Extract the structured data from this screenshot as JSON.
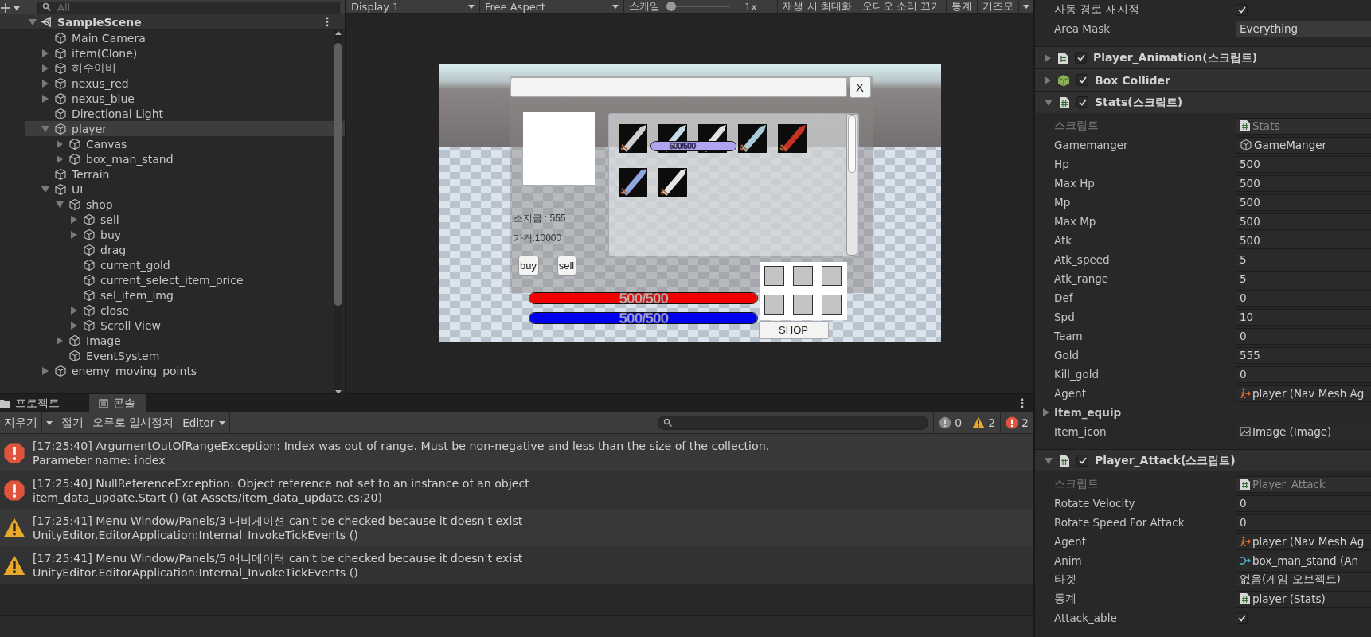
{
  "hierarchy": {
    "search": {
      "placeholder": "All"
    },
    "scene": {
      "name": "SampleScene",
      "expanded": true
    },
    "items": [
      {
        "kind": "leaf",
        "label": "Main Camera",
        "selected": false
      },
      {
        "kind": "parent",
        "label": "item(Clone)",
        "expanded": false,
        "selected": false
      },
      {
        "kind": "parent",
        "label": "허수아비",
        "expanded": false,
        "selected": false
      },
      {
        "kind": "parent",
        "label": "nexus_red",
        "expanded": false,
        "selected": false
      },
      {
        "kind": "parent",
        "label": "nexus_blue",
        "expanded": false,
        "selected": false
      },
      {
        "kind": "leaf",
        "label": "Directional Light",
        "selected": false
      },
      {
        "kind": "parent",
        "label": "player",
        "expanded": true,
        "selected": true,
        "children": [
          {
            "kind": "parent",
            "label": "Canvas",
            "expanded": false,
            "selected": false
          },
          {
            "kind": "parent",
            "label": "box_man_stand",
            "expanded": false,
            "selected": false
          }
        ]
      },
      {
        "kind": "leaf",
        "label": "Terrain",
        "selected": false
      },
      {
        "kind": "parent",
        "label": "UI",
        "expanded": true,
        "selected": false,
        "children": [
          {
            "kind": "parent",
            "label": "shop",
            "expanded": true,
            "selected": false,
            "children": [
              {
                "kind": "parent",
                "label": "sell",
                "expanded": false,
                "selected": false
              },
              {
                "kind": "parent",
                "label": "buy",
                "expanded": false,
                "selected": false
              },
              {
                "kind": "leaf",
                "label": "drag",
                "selected": false
              },
              {
                "kind": "leaf",
                "label": "current_gold",
                "selected": false
              },
              {
                "kind": "leaf",
                "label": "current_select_item_price",
                "selected": false
              },
              {
                "kind": "leaf",
                "label": "sel_item_img",
                "selected": false
              },
              {
                "kind": "parent",
                "label": "close",
                "expanded": false,
                "selected": false
              },
              {
                "kind": "parent",
                "label": "Scroll View",
                "expanded": false,
                "selected": false
              }
            ]
          },
          {
            "kind": "parent",
            "label": "Image",
            "expanded": false,
            "selected": false
          },
          {
            "kind": "leaf",
            "label": "EventSystem",
            "selected": false
          }
        ]
      },
      {
        "kind": "parent",
        "label": "enemy_moving_points",
        "expanded": false,
        "selected": false
      }
    ]
  },
  "game_view": {
    "toolbar": {
      "display": "Display 1",
      "aspect": "Free Aspect",
      "scale_label": "스케일",
      "scale_slider": {
        "level": 0
      },
      "scale_reading": "1x",
      "toggles": [
        {
          "label": "재생 시 최대화",
          "on": false
        },
        {
          "label": "오디오 소리 끄기",
          "on": false
        },
        {
          "label": "통계",
          "on": false
        },
        {
          "label": "기즈모",
          "on": false
        }
      ]
    },
    "shop": {
      "close": "X",
      "item_icons": [
        {
          "color": "#d0d0d0"
        },
        {
          "color": "#c4dce6"
        },
        {
          "color": "#e2e2e2"
        },
        {
          "color": "#a9cbd8"
        },
        {
          "color": "#c83222"
        },
        {
          "color": "#8fa6e0"
        },
        {
          "color": "#e6e6e6"
        }
      ],
      "gold": "소지금 : 555",
      "price": "가격:10000",
      "buttons": [
        {
          "label": "buy"
        },
        {
          "label": "sell"
        }
      ]
    },
    "overhead_hp": {
      "level": 1,
      "reading": "500/500"
    },
    "hp_bar": {
      "level": 1,
      "reading": "500/500"
    },
    "mp_bar": {
      "level": 1,
      "reading": "500/500"
    },
    "shop_button": "SHOP"
  },
  "console": {
    "tabs": [
      {
        "label": "프로젝트",
        "selected": false
      },
      {
        "label": "콘솔",
        "selected": true
      }
    ],
    "toolbar": {
      "clear": "지우기",
      "collapse": "접기",
      "error_pause": "오류로 일시정지",
      "editor": "Editor",
      "counts": [
        {
          "kind": "log",
          "count": "0"
        },
        {
          "kind": "warning",
          "count": "2"
        },
        {
          "kind": "error",
          "count": "2"
        }
      ]
    },
    "messages": [
      {
        "kind": "error",
        "line1": "[17:25:40] ArgumentOutOfRangeException: Index was out of range. Must be non-negative and less than the size of the collection.",
        "line2": "Parameter name: index"
      },
      {
        "kind": "error",
        "line1": "[17:25:40] NullReferenceException: Object reference not set to an instance of an object",
        "line2": "item_data_update.Start () (at Assets/item_data_update.cs:20)"
      },
      {
        "kind": "warning",
        "line1": "[17:25:41] Menu Window/Panels/3 내비게이션  can't be checked because it doesn't exist",
        "line2": "UnityEditor.EditorApplication:Internal_InvokeTickEvents ()"
      },
      {
        "kind": "warning",
        "line1": "[17:25:41] Menu Window/Panels/5 애니메이터  can't be checked because it doesn't exist",
        "line2": "UnityEditor.EditorApplication:Internal_InvokeTickEvents ()"
      }
    ]
  },
  "inspector": {
    "rows": [
      {
        "kind": "checkbox",
        "label": "자동 경로 재지정",
        "checked": true
      },
      {
        "kind": "dropdown",
        "label": "Area Mask",
        "value": "Everything"
      }
    ],
    "components": [
      {
        "title": "Player_Animation(스크립트)",
        "kind": "script",
        "enabled": true,
        "expanded": false
      },
      {
        "title": "Box Collider",
        "kind": "collider",
        "enabled": true,
        "expanded": false
      },
      {
        "title": "Stats(스크립트)",
        "kind": "script",
        "enabled": true,
        "expanded": true,
        "fields": [
          {
            "kind": "script",
            "label": "스크립트",
            "value": "Stats"
          },
          {
            "kind": "gameobject",
            "label": "Gamemanger",
            "value": "GameManger"
          },
          {
            "kind": "number",
            "label": "Hp",
            "value": "500"
          },
          {
            "kind": "number",
            "label": "Max Hp",
            "value": "500"
          },
          {
            "kind": "number",
            "label": "Mp",
            "value": "500"
          },
          {
            "kind": "number",
            "label": "Max Mp",
            "value": "500"
          },
          {
            "kind": "number",
            "label": "Atk",
            "value": "500"
          },
          {
            "kind": "number",
            "label": "Atk_speed",
            "value": "5"
          },
          {
            "kind": "number",
            "label": "Atk_range",
            "value": "5"
          },
          {
            "kind": "number",
            "label": "Def",
            "value": "0"
          },
          {
            "kind": "number",
            "label": "Spd",
            "value": "10"
          },
          {
            "kind": "number",
            "label": "Team",
            "value": "0"
          },
          {
            "kind": "number",
            "label": "Gold",
            "value": "555"
          },
          {
            "kind": "number",
            "label": "Kill_gold",
            "value": "0"
          },
          {
            "kind": "agent",
            "label": "Agent",
            "value": "player (Nav Mesh Ag"
          },
          {
            "kind": "foldout",
            "label": "Item_equip",
            "expanded": false
          },
          {
            "kind": "image",
            "label": "Item_icon",
            "value": "Image (Image)"
          }
        ]
      },
      {
        "title": "Player_Attack(스크립트)",
        "kind": "script",
        "enabled": true,
        "expanded": true,
        "fields": [
          {
            "kind": "script",
            "label": "스크립트",
            "value": "Player_Attack"
          },
          {
            "kind": "number",
            "label": "Rotate Velocity",
            "value": "0"
          },
          {
            "kind": "number",
            "label": "Rotate Speed For Attack",
            "value": "0"
          },
          {
            "kind": "agent",
            "label": "Agent",
            "value": "player (Nav Mesh Ag"
          },
          {
            "kind": "animator",
            "label": "Anim",
            "value": "box_man_stand (An"
          },
          {
            "kind": "empty",
            "label": "타겟",
            "value": "없음(게임 오브젝트)"
          },
          {
            "kind": "scriptref",
            "label": "통계",
            "value": "player (Stats)"
          },
          {
            "kind": "checkbox",
            "label": "Attack_able",
            "checked": true
          }
        ]
      }
    ]
  }
}
